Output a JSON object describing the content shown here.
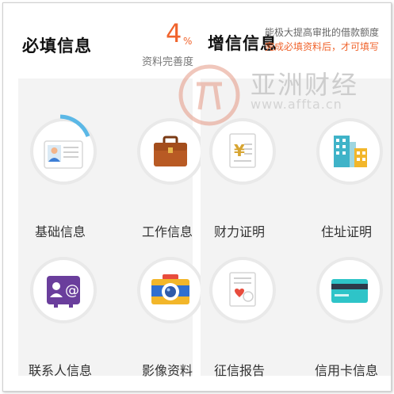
{
  "header": {
    "required_title": "必填信息",
    "progress_percent": "4",
    "percent_sign": "%",
    "progress_label": "资料完善度",
    "optional_title": "增信信息",
    "hint_line1": "能极大提高审批的借款额度",
    "hint_line2": "完成必填资料后，才可填写"
  },
  "watermark": {
    "logo_text": "亣",
    "brand": "亚洲财经",
    "url": "www.affta.cn"
  },
  "required_items": [
    {
      "label": "基础信息",
      "icon": "id-card-icon"
    },
    {
      "label": "工作信息",
      "icon": "briefcase-icon"
    },
    {
      "label": "联系人信息",
      "icon": "contacts-icon"
    },
    {
      "label": "影像资料",
      "icon": "camera-icon"
    }
  ],
  "optional_items": [
    {
      "label": "财力证明",
      "icon": "income-document-icon"
    },
    {
      "label": "住址证明",
      "icon": "building-icon"
    },
    {
      "label": "征信报告",
      "icon": "credit-report-icon"
    },
    {
      "label": "信用卡信息",
      "icon": "credit-card-icon"
    }
  ],
  "colors": {
    "accent": "#f0642d",
    "progress_arc": "#5bb8e6",
    "panel_bg": "#f3f3f3"
  }
}
